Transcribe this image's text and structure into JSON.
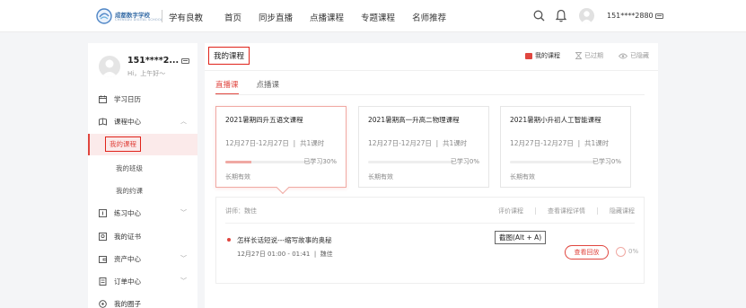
{
  "header": {
    "school_name": "成都数字学校",
    "school_subtitle": "CHENGDU DIGITAL SCHOOL",
    "brand": "学有良教",
    "nav": [
      "首页",
      "同步直播",
      "点播课程",
      "专题课程",
      "名师推荐"
    ],
    "user": "151****2880"
  },
  "sidebar": {
    "profile_name": "151****2...",
    "greeting": "Hi，上午好～",
    "items": [
      {
        "label": "学习日历"
      },
      {
        "label": "课程中心"
      },
      {
        "label": "练习中心"
      },
      {
        "label": "我的证书"
      },
      {
        "label": "资产中心"
      },
      {
        "label": "订单中心"
      },
      {
        "label": "我的圈子"
      }
    ],
    "sub_items": [
      "我的课程",
      "我的班级",
      "我的约课"
    ]
  },
  "main": {
    "title": "我的课程",
    "head_links": [
      "我的课程",
      "已过期",
      "已隐藏"
    ],
    "tabs": [
      "直播课",
      "点播课"
    ],
    "courses": [
      {
        "title": "2021暑期四升五语文课程",
        "date": "12月27日-12月27日",
        "hours": "共1课时",
        "progress_text": "已学习30%",
        "progress": 30,
        "valid": "长期有效"
      },
      {
        "title": "2021暑期高一升高二物理课程",
        "date": "12月27日-12月27日",
        "hours": "共1课时",
        "progress_text": "已学习0%",
        "progress": 0,
        "valid": "长期有效"
      },
      {
        "title": "2021暑期小升初人工智能课程",
        "date": "12月27日-12月27日",
        "hours": "共1课时",
        "progress_text": "已学习0%",
        "progress": 0,
        "valid": "长期有效"
      }
    ],
    "date_sep": "|",
    "detail": {
      "teacher": "讲师：魏佳",
      "links": [
        "评价课程",
        "查看课程详情",
        "隐藏课程"
      ],
      "lesson_title": "怎样长话短说---缩写故事的奥秘",
      "lesson_time": "12月27日 01:00 - 01:41",
      "lesson_teacher": "魏佳",
      "tooltip": "截图(Alt + A)",
      "replay": "查看回放",
      "lesson_progress": "0%"
    }
  }
}
